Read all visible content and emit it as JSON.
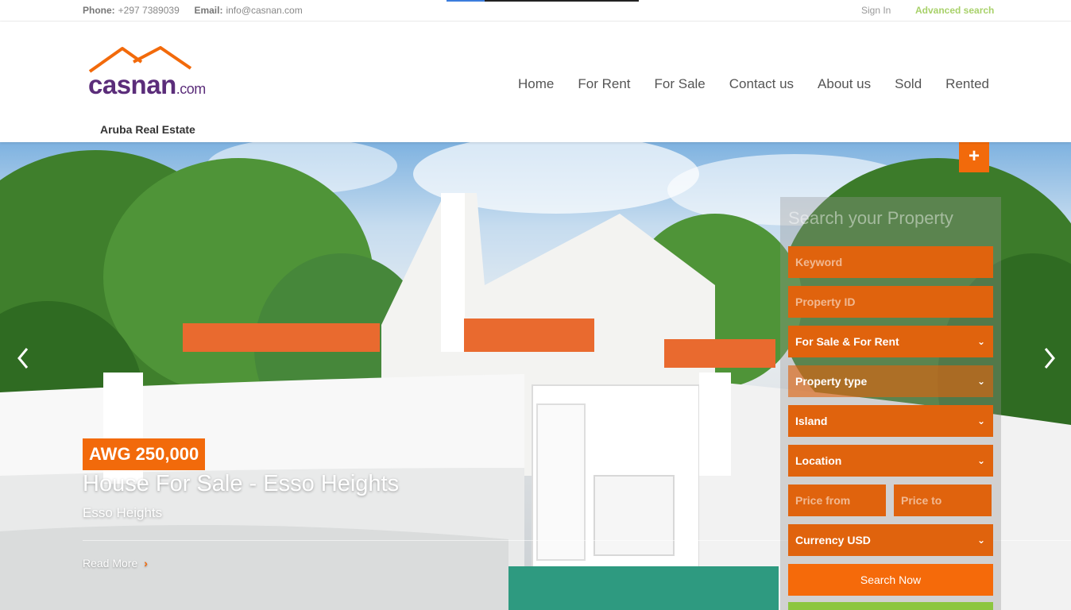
{
  "topbar": {
    "phone_label": "Phone:",
    "phone": "+297 7389039",
    "email_label": "Email:",
    "email": "info@casnan.com",
    "sign_in": "Sign In",
    "advanced_search": "Advanced search"
  },
  "logo": {
    "word": "casnan",
    "domain": ".com",
    "tagline": "Aruba Real Estate"
  },
  "nav": [
    "Home",
    "For Rent",
    "For Sale",
    "Contact us",
    "About us",
    "Sold",
    "Rented"
  ],
  "hero": {
    "plus_icon": "+",
    "price": "AWG 250,000",
    "title": "House For Sale - Esso Heights",
    "subtitle": "Esso Heights",
    "read_more": "Read More"
  },
  "search": {
    "title": "Search your Property",
    "keyword_placeholder": "Keyword",
    "property_id_placeholder": "Property ID",
    "status": "For Sale & For Rent",
    "property_type": "Property type",
    "island": "Island",
    "location": "Location",
    "price_from_placeholder": "Price from",
    "price_to_placeholder": "Price to",
    "currency": "Currency USD",
    "submit": "Search Now"
  },
  "colors": {
    "accent": "#f26a0b",
    "field": "#e0630d",
    "logo_purple": "#5b2d7a",
    "advanced_search_green": "#a8d16a",
    "strip_green": "#8cc63f"
  }
}
